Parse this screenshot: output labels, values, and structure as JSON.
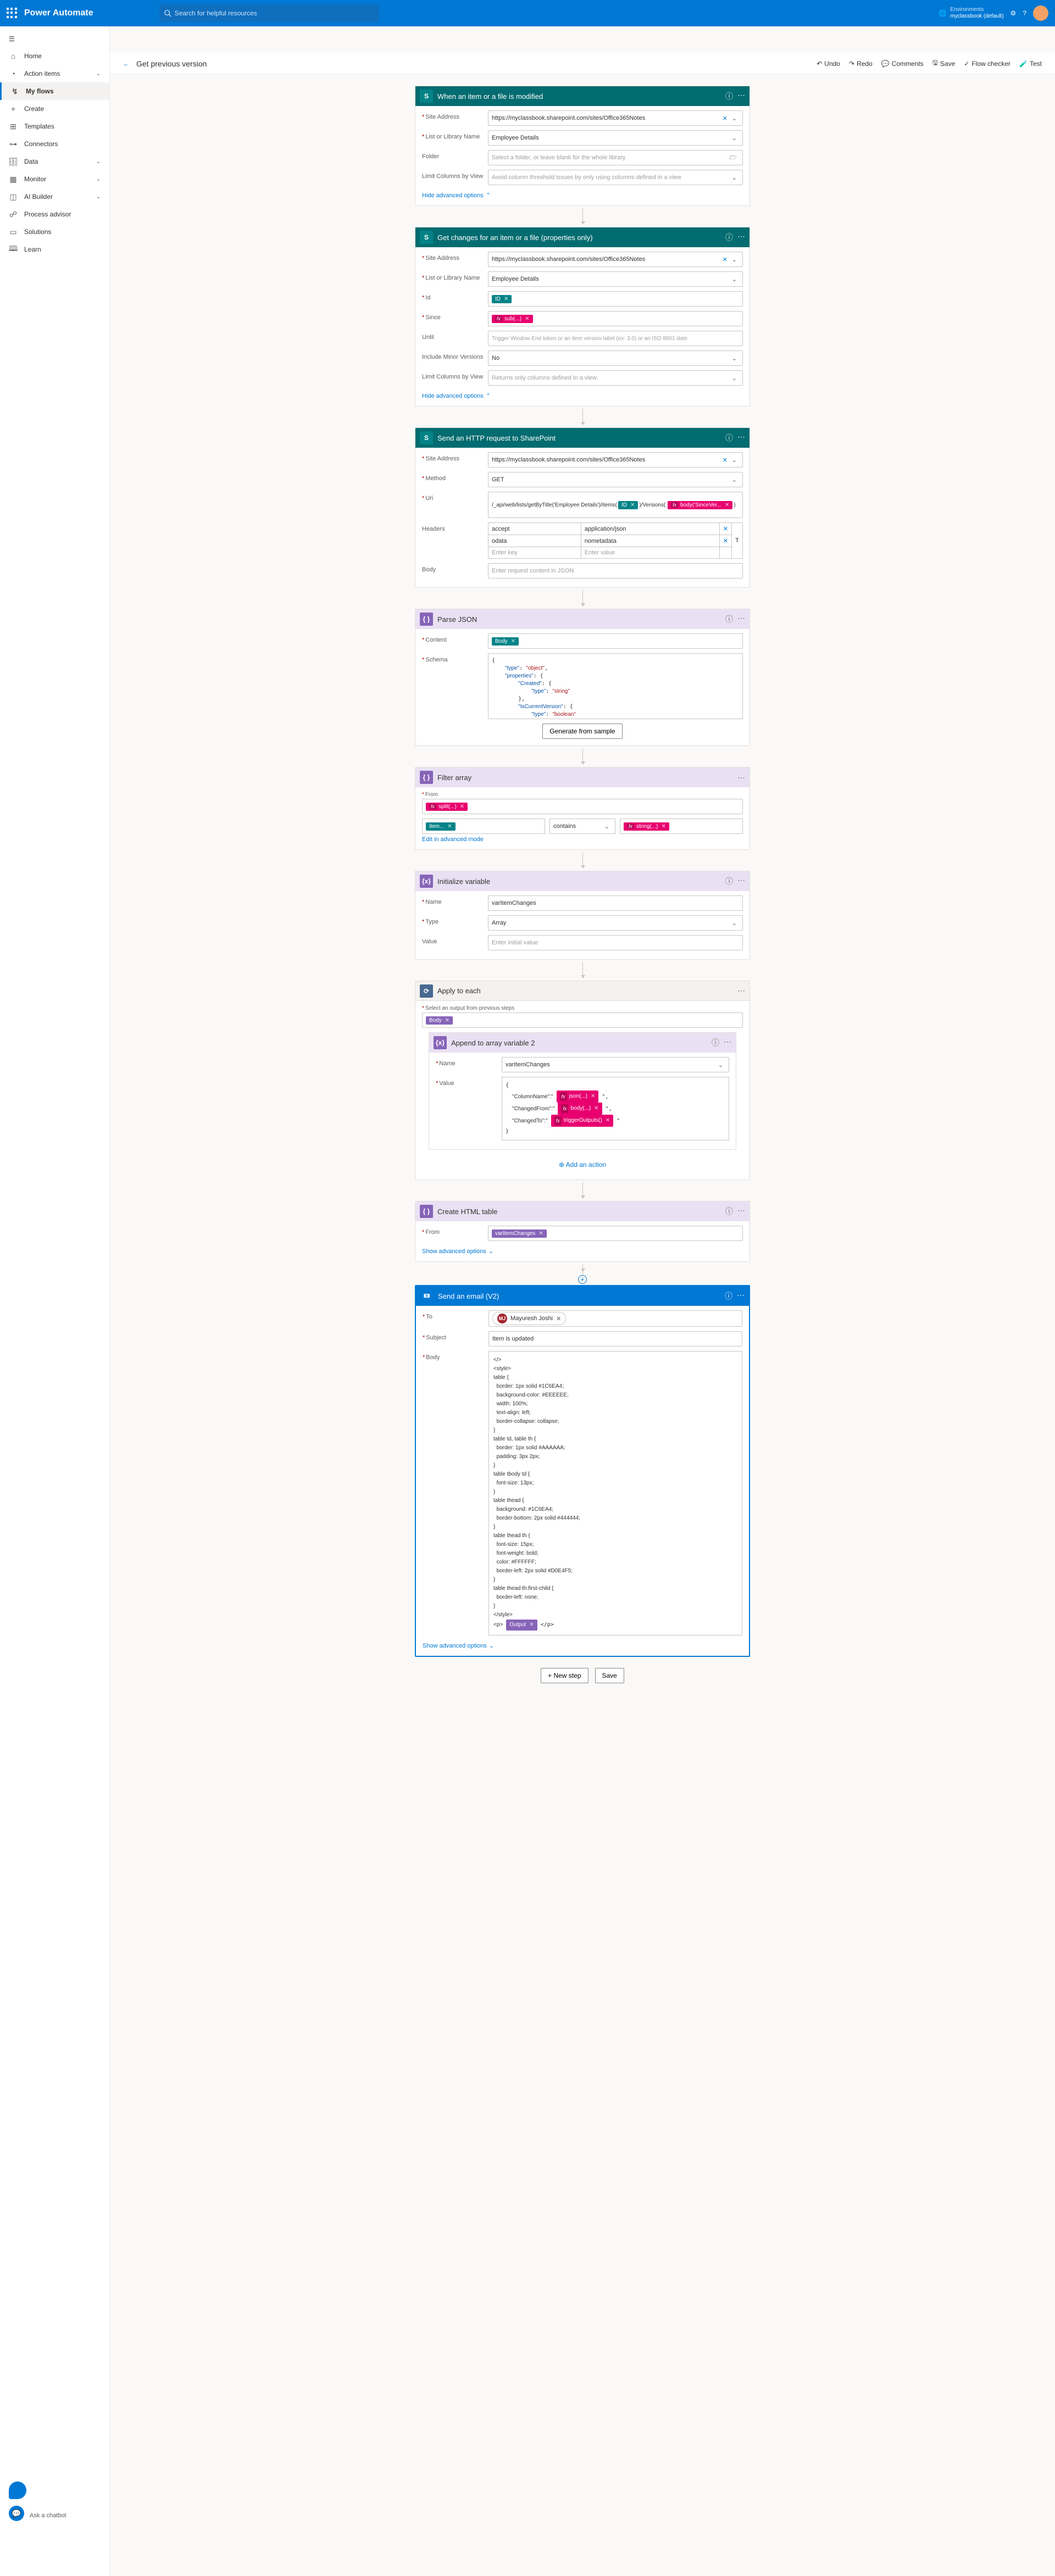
{
  "brand": "Power Automate",
  "search_placeholder": "Search for helpful resources",
  "env_label": "Environments",
  "env_name": "myclassbook (default)",
  "nav": {
    "home": "Home",
    "action": "Action items",
    "myflows": "My flows",
    "create": "Create",
    "templates": "Templates",
    "connectors": "Connectors",
    "data": "Data",
    "monitor": "Monitor",
    "ai": "AI Builder",
    "process": "Process advisor",
    "solutions": "Solutions",
    "learn": "Learn",
    "ask": "Ask a chatbot"
  },
  "cmd": {
    "title": "Get previous version",
    "undo": "Undo",
    "redo": "Redo",
    "comments": "Comments",
    "save": "Save",
    "checker": "Flow checker",
    "test": "Test"
  },
  "step1": {
    "title": "When an item or a file is modified",
    "site_label": "Site Address",
    "site_val": "https://myclassbook.sharepoint.com/sites/Office365Notes",
    "list_label": "List or Library Name",
    "list_val": "Employee Details",
    "folder_label": "Folder",
    "folder_ph": "Select a folder, or leave blank for the whole library",
    "limit_label": "Limit Columns by View",
    "limit_ph": "Avoid column threshold issues by only using columns defined in a view",
    "hide": "Hide advanced options"
  },
  "step2": {
    "title": "Get changes for an item or a file (properties only)",
    "site_label": "Site Address",
    "site_val": "https://myclassbook.sharepoint.com/sites/Office365Notes",
    "list_label": "List or Library Name",
    "list_val": "Employee Details",
    "id_label": "Id",
    "id_token": "ID",
    "since_label": "Since",
    "since_token": "sub(...)",
    "until_label": "Until",
    "until_ph": "Trigger Window End token or an item version label (ex: 3.0) or an ISO 8601 date",
    "minor_label": "Include Minor Versions",
    "minor_val": "No",
    "limit_label": "Limit Columns by View",
    "limit_ph": "Returns only columns defined in a view.",
    "hide": "Hide advanced options"
  },
  "step3": {
    "title": "Send an HTTP request to SharePoint",
    "site_label": "Site Address",
    "site_val": "https://myclassbook.sharepoint.com/sites/Office365Notes",
    "method_label": "Method",
    "method_val": "GET",
    "uri_label": "Uri",
    "uri_pre": "/_api/web/lists/getByTitle('Employee Details')/items(",
    "uri_token1": "ID",
    "uri_mid": ")/Versions(",
    "uri_token2": "body('SinceVer...",
    "uri_end": ")",
    "headers_label": "Headers",
    "h1k": "accept",
    "h1v": "application/json",
    "h2k": "odata",
    "h2v": "nometadata",
    "h3k": "Enter key",
    "h3v": "Enter value",
    "body_label": "Body",
    "body_ph": "Enter request content in JSON"
  },
  "step4": {
    "title": "Parse JSON",
    "content_label": "Content",
    "content_token": "Body",
    "schema_label": "Schema",
    "gen": "Generate from sample"
  },
  "step5": {
    "title": "Filter array",
    "from_label": "From",
    "from_token": "split(...)",
    "item_token": "item...",
    "cond": "contains",
    "val_token": "string(...)",
    "edit": "Edit in advanced mode"
  },
  "step6": {
    "title": "Initialize variable",
    "name_label": "Name",
    "name_val": "varItemChanges",
    "type_label": "Type",
    "type_val": "Array",
    "value_label": "Value",
    "value_ph": "Enter initial value"
  },
  "step7": {
    "title": "Apply to each",
    "sel_label": "Select an output from previous steps",
    "sel_token": "Body"
  },
  "step7a": {
    "title": "Append to array variable 2",
    "name_label": "Name",
    "name_val": "varItemChanges",
    "value_label": "Value",
    "col": "\"ColumnName\":\"",
    "col_token": "json(...)",
    "from": "\"ChangedFrom\":\"",
    "from_token": "body(...)",
    "to": "\"ChangedTo\":\"",
    "to_token": "triggerOutputs()",
    "add_action": "Add an action"
  },
  "step8": {
    "title": "Create HTML table",
    "from_label": "From",
    "from_token": "varItemChanges",
    "show": "Show advanced options"
  },
  "step9": {
    "title": "Send an email (V2)",
    "to_label": "To",
    "to_name": "Mayuresh Joshi",
    "subj_label": "Subject",
    "subj_val": "Item is updated",
    "body_label": "Body",
    "output_token": "Output",
    "show": "Show advanced options"
  },
  "email_body": "</>\n<style>\ntable {\n  border: 1px solid #1C6EA4;\n  background-color: #EEEEEE;\n  width: 100%;\n  text-align: left;\n  border-collapse: collapse;\n}\ntable td, table th {\n  border: 1px solid #AAAAAA;\n  padding: 3px 2px;\n}\ntable tbody td {\n  font-size: 13px;\n}\ntable thead {\n  background: #1C6EA4;\n  border-bottom: 2px solid #444444;\n}\ntable thead th {\n  font-size: 15px;\n  font-weight: bold;\n  color: #FFFFFF;\n  border-left: 2px solid #D0E4F5;\n}\ntable thead th:first-child {\n  border-left: none;\n}\n</style>\n<p>",
  "footer": {
    "new_step": "+ New step",
    "save": "Save"
  }
}
